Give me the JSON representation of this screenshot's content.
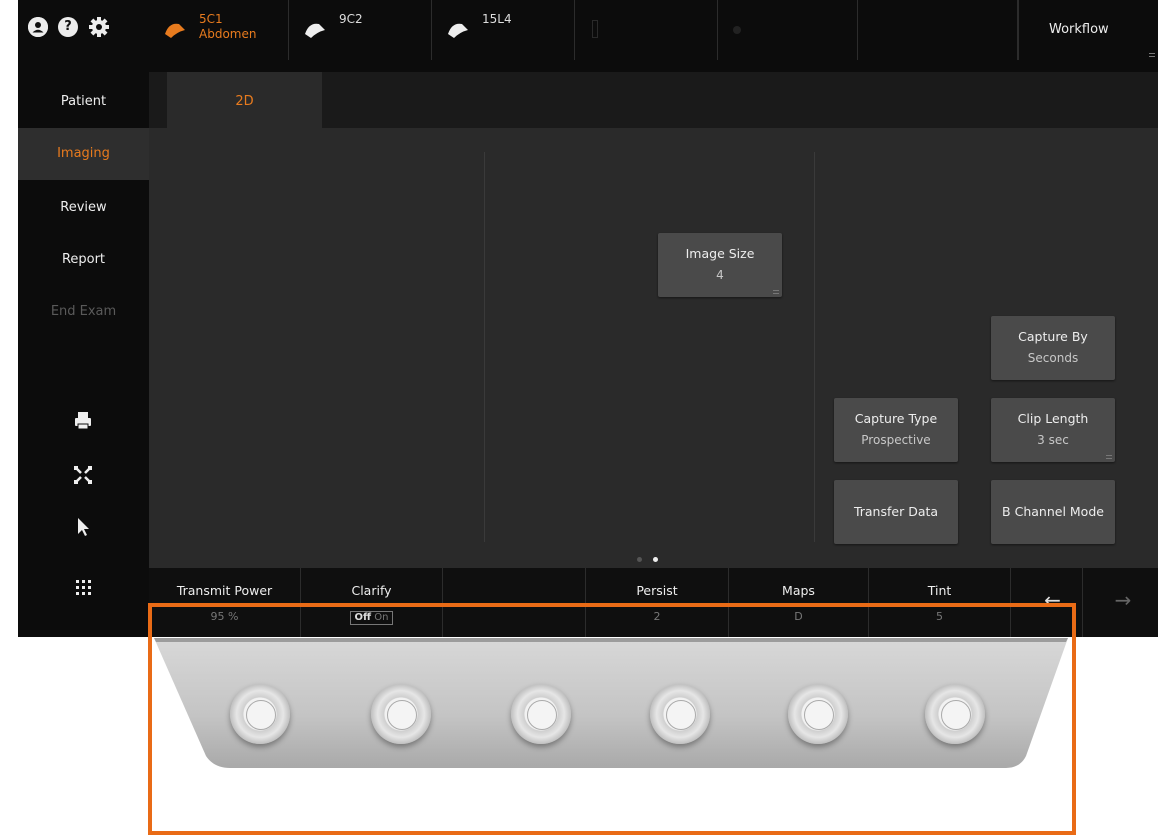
{
  "topbar": {
    "probes": [
      {
        "name": "5C1",
        "preset": "Abdomen",
        "active": true
      },
      {
        "name": "9C2",
        "active": false
      },
      {
        "name": "15L4",
        "active": false
      }
    ],
    "workflow_label": "Workflow"
  },
  "nav": {
    "items": [
      {
        "label": "Patient",
        "state": "normal"
      },
      {
        "label": "Imaging",
        "state": "active"
      },
      {
        "label": "Review",
        "state": "normal"
      },
      {
        "label": "Report",
        "state": "normal"
      },
      {
        "label": "End Exam",
        "state": "disabled"
      }
    ]
  },
  "tabs": [
    {
      "label": "2D",
      "active": true
    }
  ],
  "controls": {
    "image_size": {
      "label": "Image Size",
      "value": "4"
    },
    "capture_by": {
      "label": "Capture By",
      "value": "Seconds"
    },
    "capture_type": {
      "label": "Capture Type",
      "value": "Prospective"
    },
    "clip_length": {
      "label": "Clip Length",
      "value": "3 sec"
    },
    "transfer_data": {
      "label": "Transfer Data"
    },
    "b_channel_mode": {
      "label": "B Channel Mode"
    }
  },
  "pagination": {
    "pages": 2,
    "current": 2
  },
  "bottom": {
    "transmit_power": {
      "label": "Transmit Power",
      "value": "95 %"
    },
    "clarify": {
      "label": "Clarify",
      "off": "Off",
      "on": "On"
    },
    "persist": {
      "label": "Persist",
      "value": "2"
    },
    "maps": {
      "label": "Maps",
      "value": "D"
    },
    "tint": {
      "label": "Tint",
      "value": "5"
    }
  },
  "colors": {
    "accent": "#e87b1e",
    "highlight_frame": "#e96b16"
  },
  "hardware": {
    "knob_count": 6
  }
}
